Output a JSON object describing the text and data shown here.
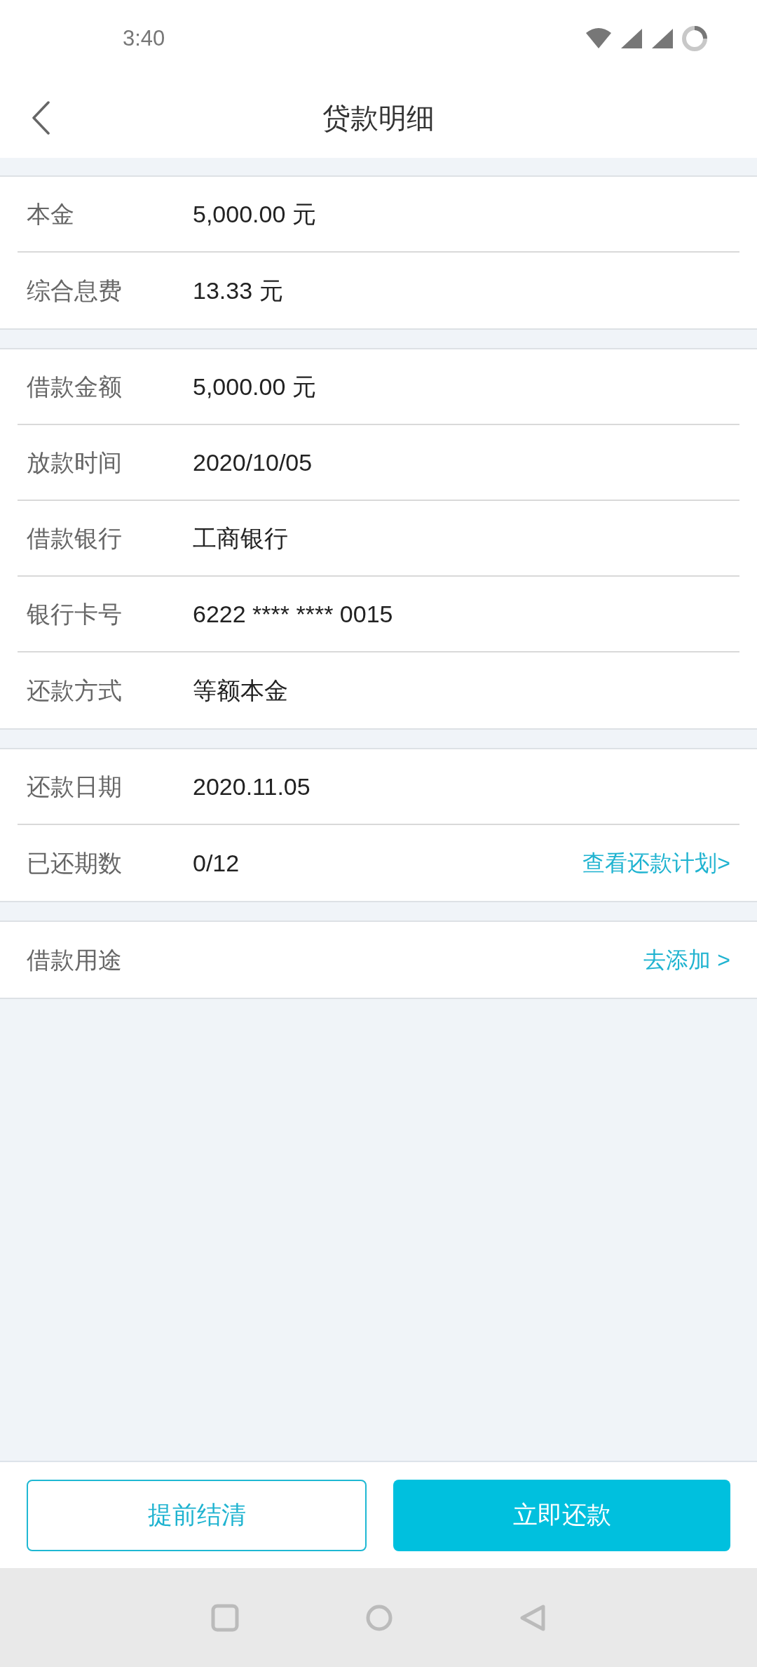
{
  "status_bar": {
    "time": "3:40"
  },
  "header": {
    "title": "贷款明细"
  },
  "sections": [
    {
      "rows": [
        {
          "label": "本金",
          "value": "5,000.00 元"
        },
        {
          "label": "综合息费",
          "value": "13.33 元"
        }
      ]
    },
    {
      "rows": [
        {
          "label": "借款金额",
          "value": "5,000.00 元"
        },
        {
          "label": "放款时间",
          "value": "2020/10/05"
        },
        {
          "label": "借款银行",
          "value": "工商银行"
        },
        {
          "label": "银行卡号",
          "value": "6222 **** **** 0015"
        },
        {
          "label": "还款方式",
          "value": "等额本金"
        }
      ]
    },
    {
      "rows": [
        {
          "label": "还款日期",
          "value": "2020.11.05"
        },
        {
          "label": "已还期数",
          "value": "0/12",
          "link": "查看还款计划>"
        }
      ]
    },
    {
      "rows": [
        {
          "label": "借款用途",
          "link": "去添加 >"
        }
      ]
    }
  ],
  "buttons": [
    {
      "label": "提前结清",
      "kind": "outline"
    },
    {
      "label": "立即还款",
      "kind": "filled"
    }
  ]
}
